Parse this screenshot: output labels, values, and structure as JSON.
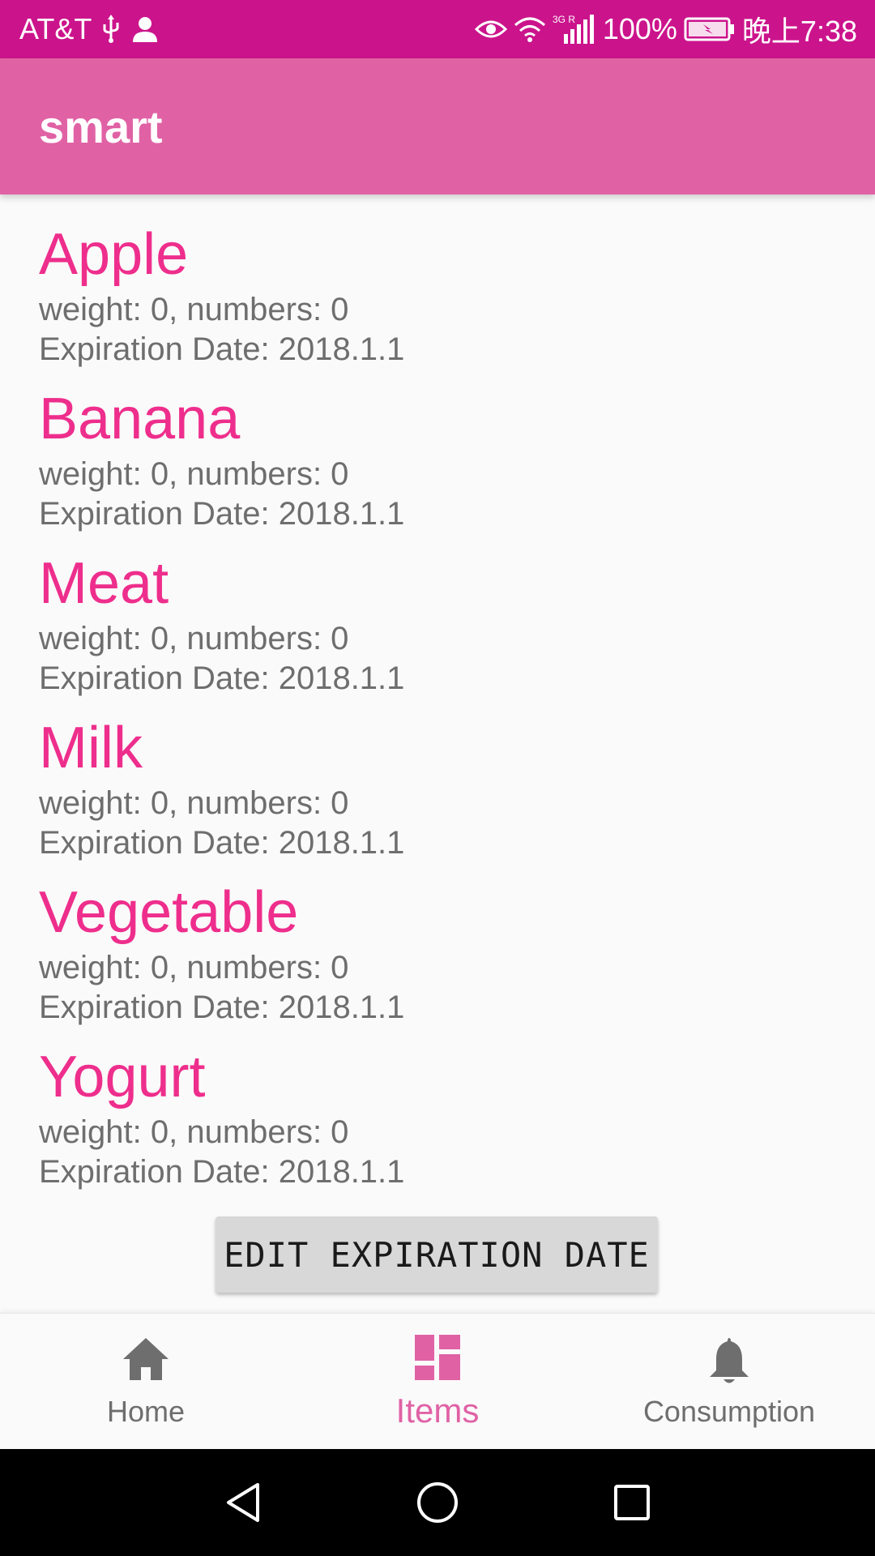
{
  "status_bar": {
    "carrier": "AT&T",
    "network": "3G",
    "battery": "100%",
    "time": "晚上7:38",
    "icons": [
      "usb-icon",
      "person-icon",
      "eye-icon",
      "wifi-icon",
      "signal-icon",
      "battery-icon"
    ]
  },
  "app_bar": {
    "title": "smart"
  },
  "items": [
    {
      "name": "Apple",
      "details": "weight: 0, numbers: 0",
      "expiration": "Expiration Date: 2018.1.1"
    },
    {
      "name": "Banana",
      "details": "weight: 0, numbers: 0",
      "expiration": "Expiration Date: 2018.1.1"
    },
    {
      "name": "Meat",
      "details": "weight: 0, numbers: 0",
      "expiration": "Expiration Date: 2018.1.1"
    },
    {
      "name": "Milk",
      "details": "weight: 0, numbers: 0",
      "expiration": "Expiration Date: 2018.1.1"
    },
    {
      "name": "Vegetable",
      "details": "weight: 0, numbers: 0",
      "expiration": "Expiration Date: 2018.1.1"
    },
    {
      "name": "Yogurt",
      "details": "weight: 0, numbers: 0",
      "expiration": "Expiration Date: 2018.1.1"
    }
  ],
  "edit_button": {
    "label": "EDIT EXPIRATION DATE"
  },
  "bottom_nav": {
    "items": [
      {
        "label": "Home",
        "icon": "home-icon",
        "active": false
      },
      {
        "label": "Items",
        "icon": "dashboard-icon",
        "active": true
      },
      {
        "label": "Consumption",
        "icon": "bell-icon",
        "active": false
      }
    ]
  },
  "system_nav": {
    "icons": [
      "back-icon",
      "home-circle-icon",
      "recents-icon"
    ]
  },
  "colors": {
    "status_bar": "#cb148c",
    "app_bar": "#e062a5",
    "item_title": "#ee2e8c",
    "item_text": "#6e6e6e",
    "nav_active": "#e062a5",
    "nav_inactive": "#6e6e6e",
    "button_bg": "#d8d8d8"
  }
}
